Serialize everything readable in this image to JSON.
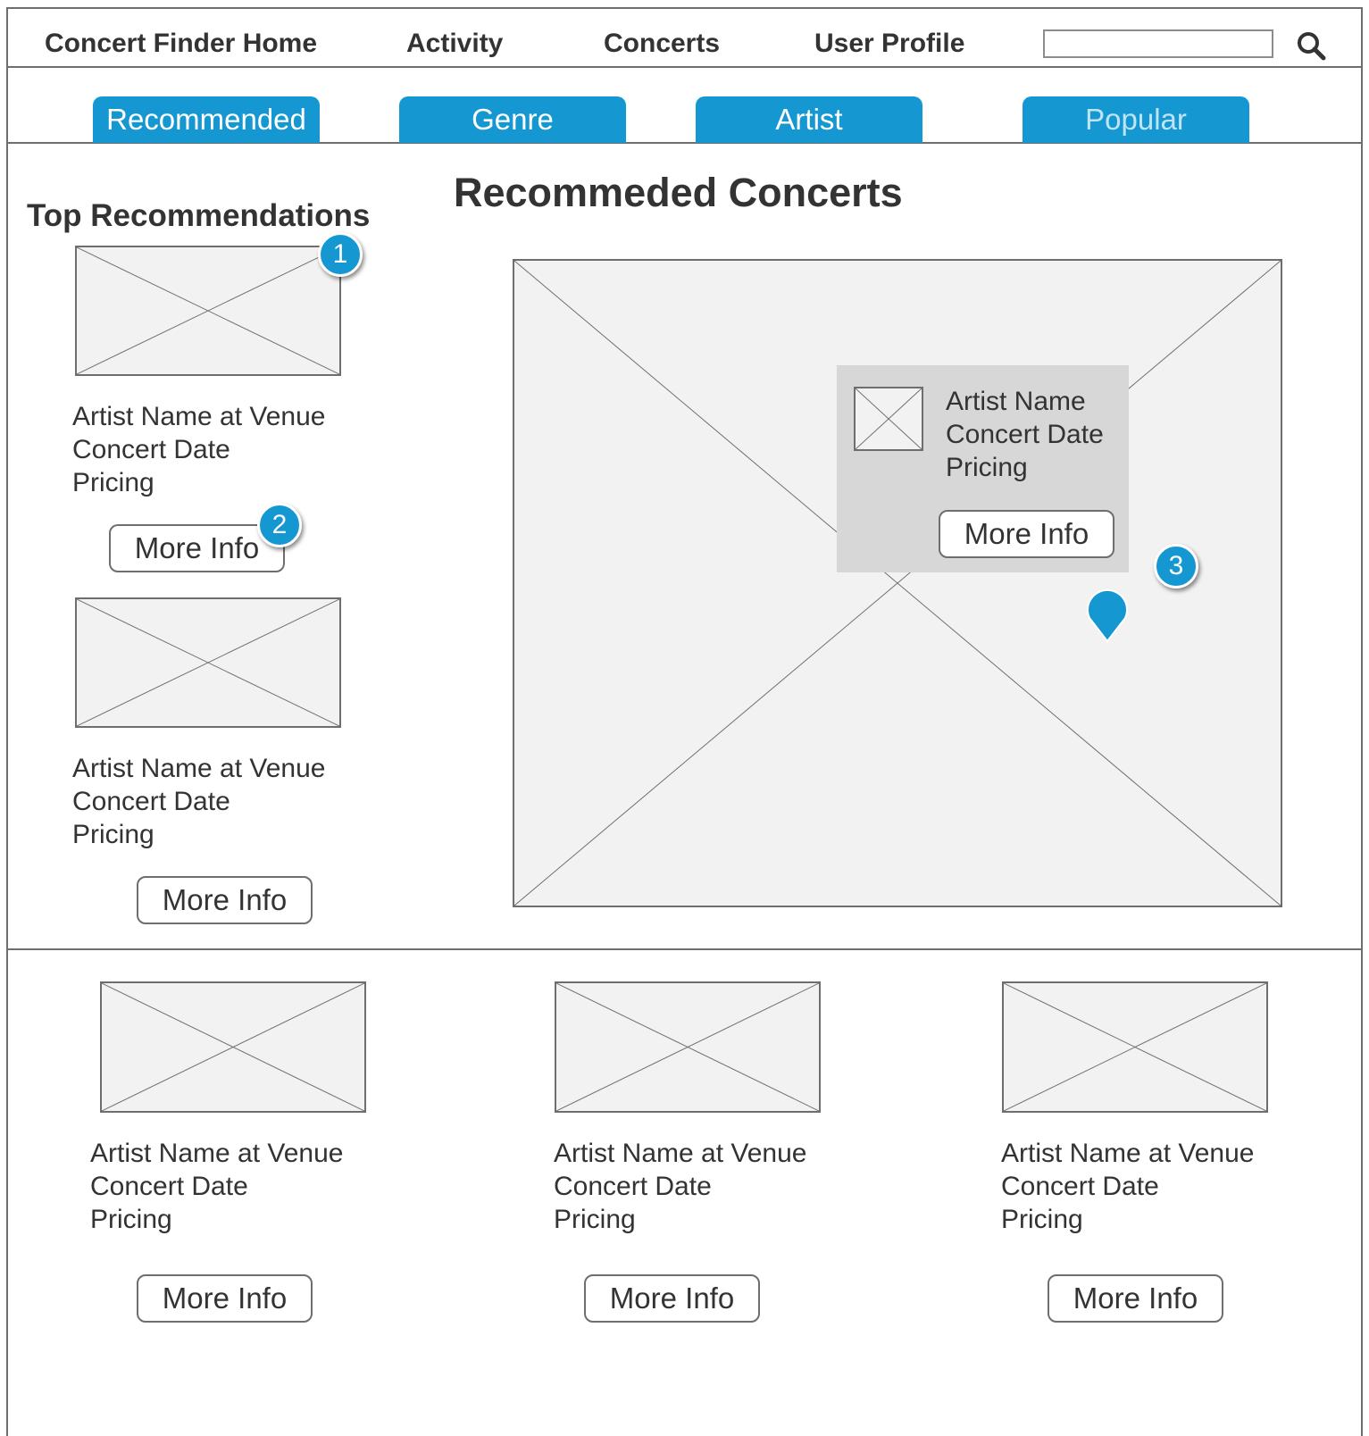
{
  "nav": {
    "home": "Concert Finder Home",
    "activity": "Activity",
    "concerts": "Concerts",
    "profile": "User Profile",
    "search_value": ""
  },
  "tabs": [
    "Recommended",
    "Genre",
    "Artist",
    "Popular"
  ],
  "sidebar": {
    "heading": "Top Recommendations",
    "items": [
      {
        "title": "Artist Name at Venue",
        "date": "Concert Date",
        "pricing": "Pricing",
        "button": "More Info"
      },
      {
        "title": "Artist Name at Venue",
        "date": "Concert Date",
        "pricing": "Pricing",
        "button": "More Info"
      }
    ]
  },
  "main": {
    "heading": "Recommeded Concerts",
    "popup": {
      "artist": "Artist Name",
      "date": "Concert Date",
      "pricing": "Pricing",
      "button": "More Info"
    }
  },
  "bottom": {
    "items": [
      {
        "title": "Artist Name at Venue",
        "date": "Concert Date",
        "pricing": "Pricing",
        "button": "More Info"
      },
      {
        "title": "Artist Name at Venue",
        "date": "Concert Date",
        "pricing": "Pricing",
        "button": "More Info"
      },
      {
        "title": "Artist Name at Venue",
        "date": "Concert Date",
        "pricing": "Pricing",
        "button": "More Info"
      }
    ]
  },
  "callouts": [
    "1",
    "2",
    "3"
  ],
  "colors": {
    "accent": "#1597d2",
    "border": "#6e6e6e",
    "placeholder": "#f2f2f2",
    "popup": "#d7d7d7"
  },
  "icons": {
    "search": "magnifier-icon",
    "map_marker": "map-pin-icon"
  }
}
